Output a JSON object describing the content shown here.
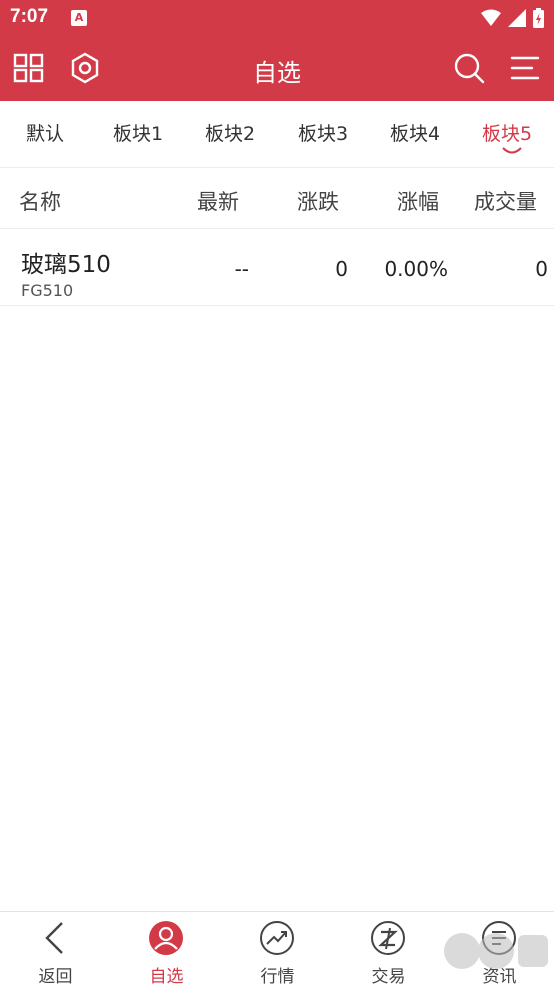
{
  "status_bar": {
    "time": "7:07",
    "notification_letter": "A"
  },
  "app_bar": {
    "title": "自选"
  },
  "tabs": [
    {
      "label": "默认",
      "active": false
    },
    {
      "label": "板块1",
      "active": false
    },
    {
      "label": "板块2",
      "active": false
    },
    {
      "label": "板块3",
      "active": false
    },
    {
      "label": "板块4",
      "active": false
    },
    {
      "label": "板块5",
      "active": true
    }
  ],
  "table": {
    "columns": [
      "名称",
      "最新",
      "涨跌",
      "涨幅",
      "成交量"
    ],
    "rows": [
      {
        "name": "玻璃510",
        "code": "FG510",
        "latest": "--",
        "change": "0",
        "change_pct": "0.00%",
        "volume": "0"
      }
    ]
  },
  "bottom_nav": [
    {
      "label": "返回",
      "icon": "back-chevron-icon",
      "active": false
    },
    {
      "label": "自选",
      "icon": "user-icon",
      "active": true
    },
    {
      "label": "行情",
      "icon": "trend-icon",
      "active": false
    },
    {
      "label": "交易",
      "icon": "exchange-icon",
      "active": false
    },
    {
      "label": "资讯",
      "icon": "news-icon",
      "active": false
    }
  ],
  "colors": {
    "accent": "#d33a48",
    "text": "#222222",
    "divider": "#ececec"
  }
}
